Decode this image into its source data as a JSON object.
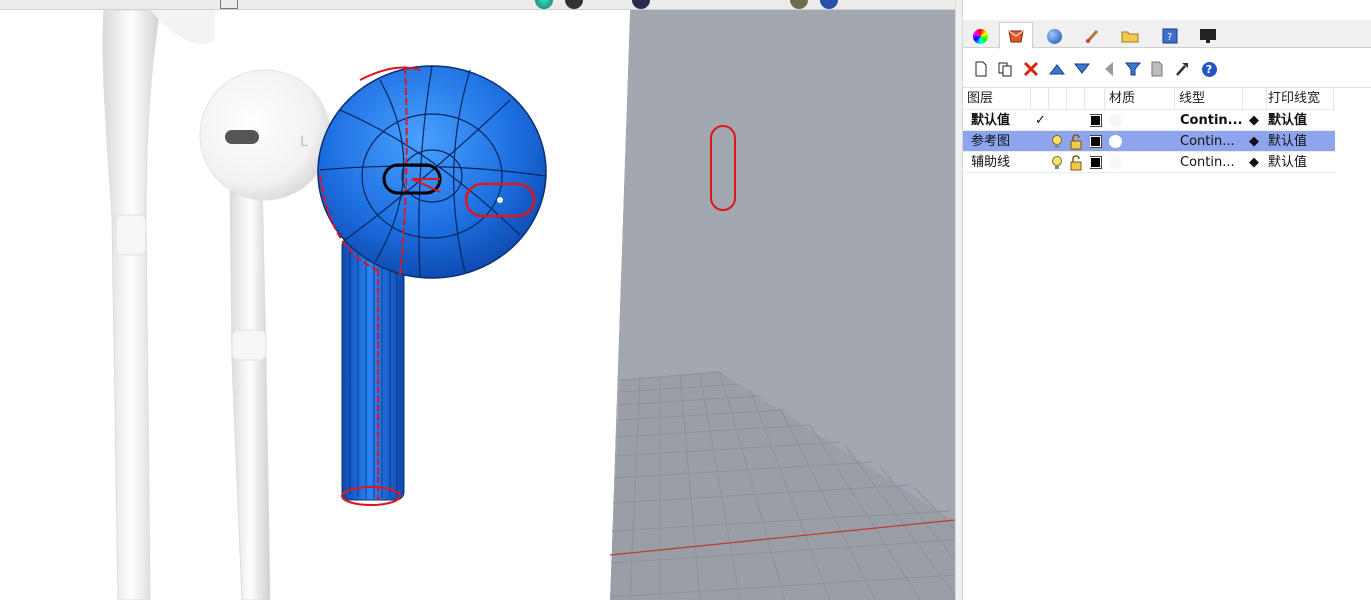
{
  "layers_panel": {
    "tabs": [
      {
        "name": "color-wheel-tab",
        "icon": "color-wheel-icon"
      },
      {
        "name": "layers-tab",
        "icon": "layers-icon",
        "active": true
      },
      {
        "name": "render-tab",
        "icon": "sphere-icon"
      },
      {
        "name": "materials-tab",
        "icon": "brush-icon"
      },
      {
        "name": "files-tab",
        "icon": "folder-icon"
      },
      {
        "name": "help-tab",
        "icon": "help-book-icon"
      },
      {
        "name": "display-tab",
        "icon": "monitor-icon"
      }
    ],
    "tools": [
      "new-layer-icon",
      "new-sublayer-icon",
      "delete-icon",
      "move-up-icon",
      "move-down-icon",
      "move-left-icon",
      "filter-icon",
      "document-icon",
      "tools-icon",
      "help-icon"
    ],
    "columns": {
      "layer": "图层",
      "material": "材质",
      "linetype": "线型",
      "print_width": "打印线宽"
    },
    "rows": [
      {
        "name": "默认值",
        "current": true,
        "current_mark": "✓",
        "linetype": "Contin...",
        "print_width": "默认值",
        "selected": false
      },
      {
        "name": "参考图",
        "current": false,
        "current_mark": "",
        "linetype": "Contin...",
        "print_width": "默认值",
        "selected": true
      },
      {
        "name": "辅助线",
        "current": false,
        "current_mark": "",
        "linetype": "Contin...",
        "print_width": "默认值",
        "selected": false
      }
    ]
  },
  "colors": {
    "selection": "#8ea5ee",
    "model_blue": "#1f73e6",
    "curve_red": "#e0161b",
    "viewport_grey": "#a3a7b0"
  }
}
